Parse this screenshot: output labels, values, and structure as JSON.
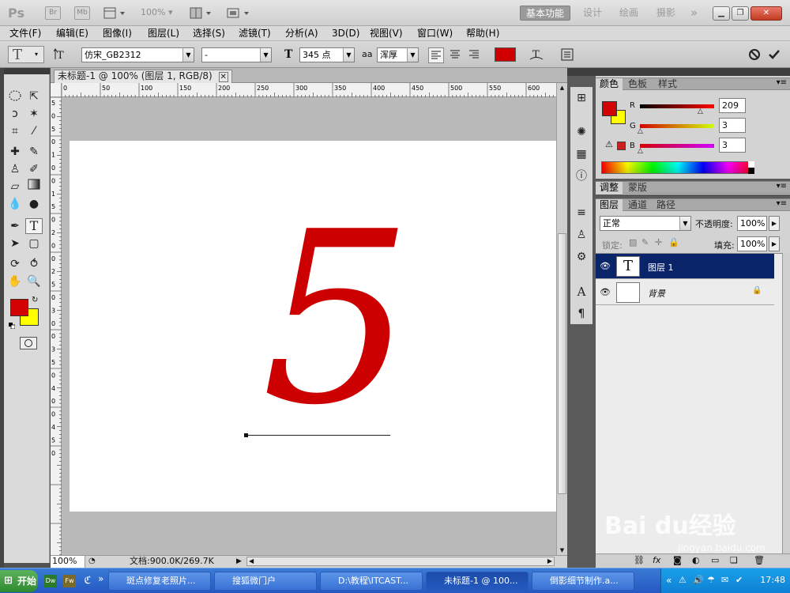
{
  "appbar": {
    "logo": "Ps",
    "br_icon": "Br",
    "mb_icon": "Mb",
    "zoom": "100%",
    "workspaces": [
      "基本功能",
      "设计",
      "绘画",
      "摄影"
    ],
    "more": "»"
  },
  "menu": [
    "文件(F)",
    "编辑(E)",
    "图像(I)",
    "图层(L)",
    "选择(S)",
    "滤镜(T)",
    "分析(A)",
    "3D(D)",
    "视图(V)",
    "窗口(W)",
    "帮助(H)"
  ],
  "options": {
    "tool_glyph": "T",
    "font_family": "仿宋_GB2312",
    "font_style": "-",
    "font_size": "345 点",
    "aa_label": "aa",
    "antialias": "浑厚",
    "text_color": "#d10000"
  },
  "document": {
    "tab_title": "未标题-1 @ 100% (图层 1, RGB/8)",
    "text_content": "5",
    "text_color": "#cc0000",
    "ruler_top": [
      "0",
      "50",
      "100",
      "150",
      "200",
      "250",
      "300",
      "350",
      "400",
      "450",
      "500",
      "550",
      "600"
    ],
    "ruler_left": [
      "5",
      "0",
      "5",
      "0",
      "1",
      "0",
      "0",
      "1",
      "5",
      "0",
      "2",
      "0",
      "0",
      "2",
      "5",
      "0",
      "3",
      "0",
      "0",
      "3",
      "5",
      "0",
      "4",
      "0",
      "0",
      "4",
      "5",
      "0"
    ]
  },
  "status": {
    "zoom": "100%",
    "doc_info": "文档:900.0K/269.7K"
  },
  "color_panel": {
    "tabs": [
      "颜色",
      "色板",
      "样式"
    ],
    "r_label": "R",
    "g_label": "G",
    "b_label": "B",
    "r": "209",
    "g": "3",
    "b": "3",
    "foreground": "#d10303",
    "background": "#ffff00"
  },
  "adjust_panel": {
    "tabs": [
      "调整",
      "蒙版"
    ]
  },
  "layers_panel": {
    "tabs": [
      "图层",
      "通道",
      "路径"
    ],
    "blend_mode": "正常",
    "opacity_label": "不透明度:",
    "opacity": "100%",
    "lock_label": "锁定:",
    "fill_label": "填充:",
    "fill": "100%",
    "layers": [
      {
        "name": "图层 1",
        "thumb": "T",
        "selected": true
      },
      {
        "name": "背景",
        "thumb": "",
        "selected": false
      }
    ]
  },
  "taskbar": {
    "start": "开始",
    "tasks": [
      "斑点修复老照片...",
      "搜狐微门户",
      "D:\\教程\\ITCAST...",
      "未标题-1 @ 100...",
      "倒影细节制作.a..."
    ],
    "clock": "17:48"
  },
  "watermark": {
    "line1": "Bai du经验",
    "line2": "jingyan.baidu.com"
  }
}
